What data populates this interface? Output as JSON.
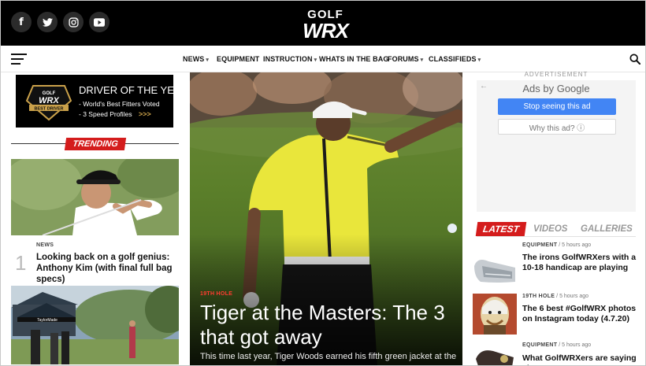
{
  "header": {
    "social": [
      {
        "name": "facebook",
        "glyph": "f"
      },
      {
        "name": "twitter",
        "glyph": "t"
      },
      {
        "name": "instagram",
        "glyph": "◎"
      },
      {
        "name": "youtube",
        "glyph": "▶"
      }
    ],
    "logo_top": "GOLF",
    "logo_bottom": "WRX"
  },
  "nav": {
    "items": [
      {
        "label": "NEWS",
        "dropdown": true
      },
      {
        "label": "EQUIPMENT",
        "dropdown": false
      },
      {
        "label": "INSTRUCTION",
        "dropdown": true
      },
      {
        "label": "WHATS IN THE BAG",
        "dropdown": false
      },
      {
        "label": "FORUMS",
        "dropdown": true
      },
      {
        "label": "CLASSIFIEDS",
        "dropdown": true
      }
    ]
  },
  "left": {
    "ad": {
      "badge_top": "GOLF",
      "badge_mid": "WRX",
      "badge_ribbon": "BEST DRIVER",
      "title": "DRIVER OF THE YEAR",
      "line1": "- World's Best Fitters Voted",
      "line2": "- 3 Speed Profiles",
      "arrows": ">>>"
    },
    "trending_label": "TRENDING",
    "story1": {
      "rank": "1",
      "category": "NEWS",
      "title": "Looking back on a golf genius: Anthony Kim (with final full bag specs)"
    }
  },
  "hero": {
    "category": "19TH HOLE",
    "title": "Tiger at the Masters: The 3 that got away",
    "excerpt": "This time last year, Tiger Woods earned his fifth green jacket at the"
  },
  "right": {
    "advertisement_label": "ADVERTISEMENT",
    "ads_by": "Ads by Google",
    "stop_button": "Stop seeing this ad",
    "why_button": "Why this ad? ⓘ",
    "tabs": [
      "LATEST",
      "VIDEOS",
      "GALLERIES"
    ],
    "latest": [
      {
        "category": "EQUIPMENT",
        "time": "5 hours ago",
        "title": "The irons GolfWRXers with a 10-18 handicap are playing"
      },
      {
        "category": "19TH HOLE",
        "time": "5 hours ago",
        "title": "The 6 best #GolfWRX photos on Instagram today (4.7.20)"
      },
      {
        "category": "EQUIPMENT",
        "time": "5 hours ago",
        "title": "What GolfWRXers are saying about"
      }
    ]
  },
  "colors": {
    "accent_red": "#d41c1c",
    "google_blue": "#4285f4",
    "header_black": "#000000"
  }
}
